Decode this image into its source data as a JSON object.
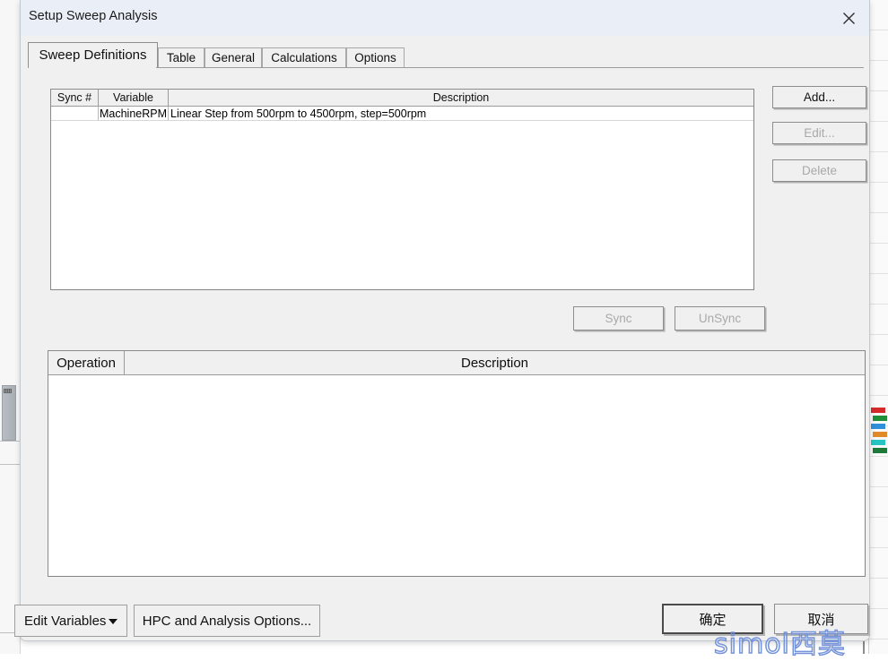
{
  "window": {
    "title": "Setup Sweep Analysis",
    "close_icon": "close-icon"
  },
  "tabs": [
    {
      "label": "Sweep Definitions",
      "active": true
    },
    {
      "label": "Table",
      "active": false
    },
    {
      "label": "General",
      "active": false
    },
    {
      "label": "Calculations",
      "active": false
    },
    {
      "label": "Options",
      "active": false
    }
  ],
  "sweep_grid": {
    "columns": [
      "Sync #",
      "Variable",
      "Description"
    ],
    "rows": [
      {
        "sync": "",
        "variable": "MachineRPM",
        "description": "Linear Step from 500rpm to 4500rpm, step=500rpm"
      }
    ]
  },
  "side_buttons": {
    "add": "Add...",
    "edit": "Edit...",
    "delete": "Delete"
  },
  "sync_buttons": {
    "sync": "Sync",
    "unsync": "UnSync"
  },
  "operation_grid": {
    "columns": [
      "Operation",
      "Description"
    ],
    "rows": []
  },
  "bottom": {
    "edit_variables": "Edit Variables",
    "edit_variables_caret": "chevron-down-icon",
    "hpc_options": "HPC and Analysis Options...",
    "ok": "确定",
    "cancel": "取消"
  },
  "watermark": {
    "text": "simol西莫"
  },
  "colors": {
    "dialog_bg": "#f0f0f0",
    "titlebar_bg": "#eaeff7",
    "grid_bg": "#ffffff",
    "grid_border": "#848484",
    "disabled_text": "#a9a9a9",
    "watermark_stroke": "#6f8fd8"
  },
  "background_bars": [
    "#d42a2a",
    "#1f8f3a",
    "#2f8fd8",
    "#e08a2a",
    "#27c4c4",
    "#1f7a3a"
  ]
}
